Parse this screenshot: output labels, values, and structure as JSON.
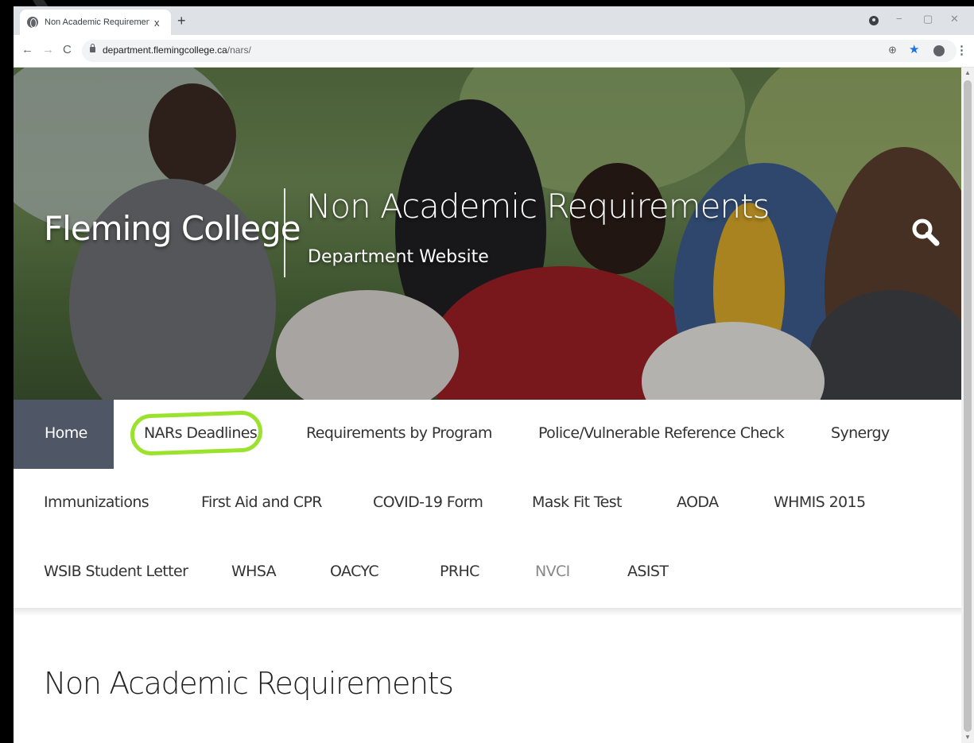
{
  "browser": {
    "tab_title": "Non Academic Requirements | D",
    "tab_close": "x",
    "new_tab": "+",
    "url_host": "department.flemingcollege.ca",
    "url_path": "/nars/",
    "nav": {
      "back": "←",
      "forward": "→",
      "reload": "C"
    },
    "window_controls": {
      "minimize": "−",
      "maximize": "▢",
      "close": "✕"
    }
  },
  "hero": {
    "brand": "Fleming College",
    "title": "Non Academic Requirements",
    "subtitle": "Department Website"
  },
  "menu": {
    "active": "Home",
    "row1": [
      "NARs Deadlines",
      "Requirements by Program",
      "Police/Vulnerable Reference Check",
      "Synergy"
    ],
    "row2": [
      "Immunizations",
      "First Aid and CPR",
      "COVID-19 Form",
      "Mask Fit Test",
      "AODA",
      "WHMIS 2015"
    ],
    "row3": [
      "WSIB Student Letter",
      "WHSA",
      "OACYC",
      "PRHC",
      "NVCI",
      "ASIST"
    ],
    "highlighted": "NARs Deadlines",
    "highlight_color": "#9be22c",
    "active_bg": "#4f5767"
  },
  "main": {
    "heading": "Non Academic Requirements"
  }
}
